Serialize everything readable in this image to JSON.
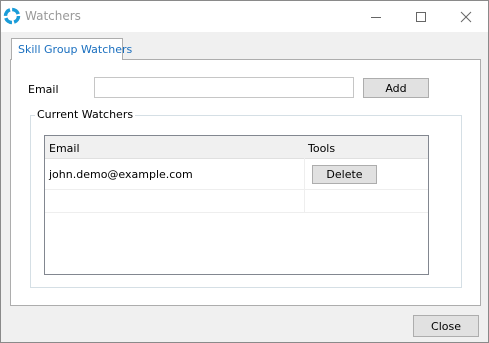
{
  "window": {
    "title": "Watchers",
    "colors": {
      "app_icon": "#1a9cd8",
      "tab_text": "#1a6fbf",
      "title_text": "#999999"
    }
  },
  "tabs": [
    {
      "label": "Skill Group Watchers",
      "selected": true
    }
  ],
  "form": {
    "email_label": "Email",
    "email_value": "",
    "add_label": "Add"
  },
  "watchers": {
    "group_label": "Current Watchers",
    "columns": [
      "Email",
      "Tools"
    ],
    "rows": [
      {
        "email": "john.demo@example.com",
        "action": "Delete"
      }
    ]
  },
  "footer": {
    "close_label": "Close"
  }
}
